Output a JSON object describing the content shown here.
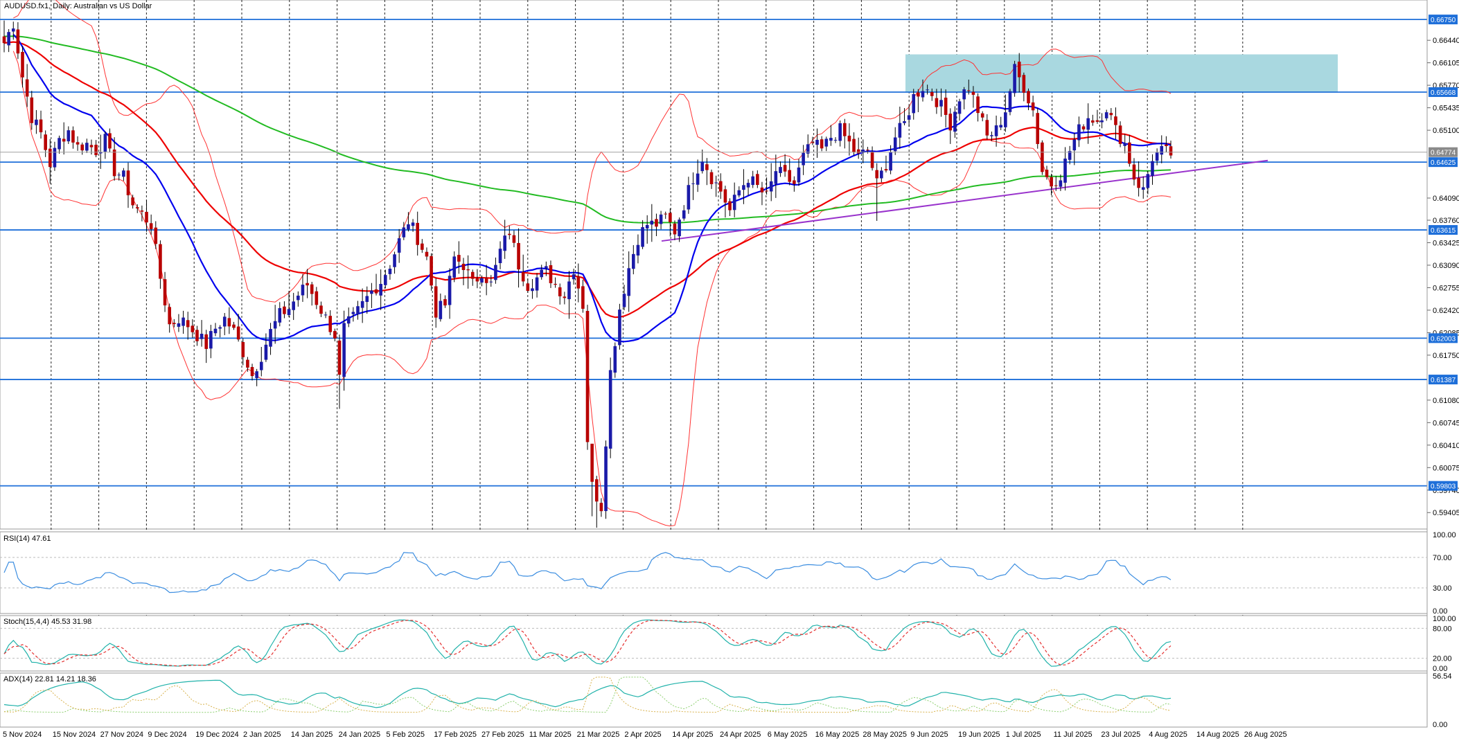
{
  "chart_data": {
    "type": "candlestick",
    "symbol_title": "AUDUSD.fx1, Daily:  Australian vs US Dollar",
    "date_labels": [
      "5 Nov 2024",
      "15 Nov 2024",
      "27 Nov 2024",
      "9 Dec 2024",
      "19 Dec 2024",
      "2 Jan 2025",
      "14 Jan 2025",
      "24 Jan 2025",
      "5 Feb 2025",
      "17 Feb 2025",
      "27 Feb 2025",
      "11 Mar 2025",
      "21 Mar 2025",
      "2 Apr 2025",
      "14 Apr 2025",
      "24 Apr 2025",
      "6 May 2025",
      "16 May 2025",
      "28 May 2025",
      "9 Jun 2025",
      "19 Jun 2025",
      "1 Jul 2025",
      "11 Jul 2025",
      "23 Jul 2025",
      "4 Aug 2025",
      "14 Aug 2025",
      "26 Aug 2025"
    ],
    "price_ticks": [
      "0.66440",
      "0.66105",
      "0.65770",
      "0.65435",
      "0.65100",
      "0.64090",
      "0.63760",
      "0.63425",
      "0.63090",
      "0.62755",
      "0.62420",
      "0.62085",
      "0.61750",
      "0.61080",
      "0.60745",
      "0.60410",
      "0.60075",
      "0.59740",
      "0.59405"
    ],
    "price_range": [
      0.5916,
      0.6704
    ],
    "horizontal_levels": [
      "0.66750",
      "0.65668",
      "0.64774",
      "0.64625",
      "0.63615",
      "0.62003",
      "0.61387",
      "0.59803"
    ],
    "current_price": "0.64774",
    "resistance_zone": {
      "from": 0.6566,
      "to": 0.6623,
      "start_date": "19 Jun 2025",
      "end_date": "14 Aug 2025"
    },
    "trendline": {
      "from": {
        "date": "24 Apr 2025",
        "price": 0.6345
      },
      "to": {
        "date": "26 Aug 2025",
        "price": 0.6465
      }
    },
    "indicators": {
      "rsi": {
        "label": "RSI(14) 47.61",
        "ticks": [
          "100.00",
          "70.00",
          "30.00",
          "0.00"
        ],
        "value": 47.61
      },
      "stoch": {
        "label": "Stoch(15,4,4) 45.53 31.98",
        "ticks": [
          "100.00",
          "80.00",
          "20.00",
          "0.00"
        ]
      },
      "adx": {
        "label": "ADX(14) 22.81 14.21 18.36",
        "ticks": [
          "56.54",
          "0.00"
        ]
      }
    },
    "colors": {
      "bull": "#1a1aa8",
      "bear": "#b80000",
      "ma_fast": "#0000ee",
      "ma_mid": "#ee0000",
      "ma_slow": "#22bb22",
      "bands": "#ff3333",
      "levels": "#1e6fd9",
      "trend": "#9933cc",
      "zone": "#a9d8e0"
    },
    "anchors": [
      [
        0,
        0.664
      ],
      [
        2,
        0.667
      ],
      [
        4,
        0.659
      ],
      [
        6,
        0.653
      ],
      [
        8,
        0.6505
      ],
      [
        10,
        0.646
      ],
      [
        12,
        0.6495
      ],
      [
        14,
        0.651
      ],
      [
        16,
        0.6485
      ],
      [
        18,
        0.649
      ],
      [
        20,
        0.648
      ],
      [
        22,
        0.6495
      ],
      [
        24,
        0.645
      ],
      [
        26,
        0.644
      ],
      [
        28,
        0.64
      ],
      [
        30,
        0.6385
      ],
      [
        32,
        0.637
      ],
      [
        34,
        0.629
      ],
      [
        36,
        0.622
      ],
      [
        38,
        0.623
      ],
      [
        40,
        0.622
      ],
      [
        42,
        0.6205
      ],
      [
        44,
        0.619
      ],
      [
        46,
        0.6215
      ],
      [
        48,
        0.623
      ],
      [
        50,
        0.621
      ],
      [
        52,
        0.618
      ],
      [
        54,
        0.6145
      ],
      [
        56,
        0.6175
      ],
      [
        58,
        0.621
      ],
      [
        60,
        0.6235
      ],
      [
        62,
        0.6245
      ],
      [
        64,
        0.6265
      ],
      [
        66,
        0.628
      ],
      [
        68,
        0.6255
      ],
      [
        70,
        0.623
      ],
      [
        72,
        0.6205
      ],
      [
        73,
        0.614
      ],
      [
        74,
        0.6215
      ],
      [
        76,
        0.623
      ],
      [
        78,
        0.625
      ],
      [
        80,
        0.627
      ],
      [
        82,
        0.6285
      ],
      [
        84,
        0.631
      ],
      [
        86,
        0.6345
      ],
      [
        88,
        0.6375
      ],
      [
        90,
        0.635
      ],
      [
        92,
        0.632
      ],
      [
        94,
        0.624
      ],
      [
        96,
        0.625
      ],
      [
        98,
        0.632
      ],
      [
        100,
        0.631
      ],
      [
        102,
        0.628
      ],
      [
        104,
        0.63
      ],
      [
        106,
        0.628
      ],
      [
        108,
        0.633
      ],
      [
        110,
        0.636
      ],
      [
        112,
        0.631
      ],
      [
        114,
        0.628
      ],
      [
        116,
        0.629
      ],
      [
        118,
        0.63
      ],
      [
        120,
        0.628
      ],
      [
        122,
        0.6265
      ],
      [
        124,
        0.6305
      ],
      [
        126,
        0.625
      ],
      [
        127,
        0.605
      ],
      [
        128,
        0.598
      ],
      [
        130,
        0.595
      ],
      [
        132,
        0.615
      ],
      [
        134,
        0.6245
      ],
      [
        136,
        0.6305
      ],
      [
        138,
        0.635
      ],
      [
        140,
        0.637
      ],
      [
        142,
        0.637
      ],
      [
        144,
        0.638
      ],
      [
        146,
        0.636
      ],
      [
        148,
        0.64
      ],
      [
        150,
        0.644
      ],
      [
        152,
        0.647
      ],
      [
        154,
        0.644
      ],
      [
        156,
        0.642
      ],
      [
        158,
        0.639
      ],
      [
        160,
        0.642
      ],
      [
        162,
        0.644
      ],
      [
        164,
        0.6425
      ],
      [
        166,
        0.641
      ],
      [
        168,
        0.645
      ],
      [
        170,
        0.644
      ],
      [
        172,
        0.643
      ],
      [
        174,
        0.647
      ],
      [
        176,
        0.649
      ],
      [
        178,
        0.648
      ],
      [
        180,
        0.65
      ],
      [
        182,
        0.651
      ],
      [
        184,
        0.649
      ],
      [
        186,
        0.647
      ],
      [
        188,
        0.648
      ],
      [
        190,
        0.643
      ],
      [
        192,
        0.646
      ],
      [
        194,
        0.65
      ],
      [
        196,
        0.652
      ],
      [
        198,
        0.656
      ],
      [
        200,
        0.6575
      ],
      [
        202,
        0.6565
      ],
      [
        204,
        0.6545
      ],
      [
        206,
        0.652
      ],
      [
        208,
        0.656
      ],
      [
        210,
        0.6575
      ],
      [
        212,
        0.654
      ],
      [
        214,
        0.65
      ],
      [
        216,
        0.651
      ],
      [
        218,
        0.654
      ],
      [
        220,
        0.66
      ],
      [
        222,
        0.6575
      ],
      [
        224,
        0.654
      ],
      [
        226,
        0.645
      ],
      [
        228,
        0.643
      ],
      [
        230,
        0.6445
      ],
      [
        232,
        0.648
      ],
      [
        234,
        0.651
      ],
      [
        236,
        0.653
      ],
      [
        238,
        0.6525
      ],
      [
        240,
        0.6545
      ],
      [
        242,
        0.651
      ],
      [
        244,
        0.649
      ],
      [
        246,
        0.644
      ],
      [
        248,
        0.642
      ],
      [
        250,
        0.647
      ],
      [
        252,
        0.6478
      ],
      [
        254,
        0.6475
      ]
    ]
  }
}
